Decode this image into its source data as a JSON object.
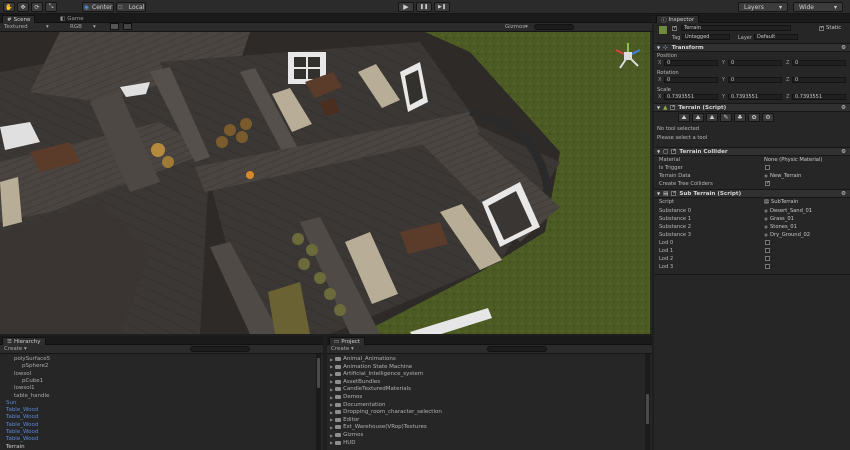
{
  "toolbar": {
    "pivot_center": "Center",
    "pivot_local": "Local",
    "play_symbol": "▶",
    "pause_symbol": "❚❚",
    "step_symbol": "▶❚",
    "layers": "Layers",
    "layout": "Wide"
  },
  "scene": {
    "tab_scene": "Scene",
    "tab_game": "Game",
    "draw_mode": "Textured",
    "render_mode": "RGB",
    "gizmos": "Gizmos",
    "search_placeholder": "All"
  },
  "inspector": {
    "tab": "Inspector",
    "object_name": "Terrain",
    "static_label": "Static",
    "tag_label": "Tag",
    "tag_value": "Untagged",
    "layer_label": "Layer",
    "layer_value": "Default",
    "transform": {
      "title": "Transform",
      "position_label": "Position",
      "rotation_label": "Rotation",
      "scale_label": "Scale",
      "position": [
        "0",
        "0",
        "0"
      ],
      "rotation": [
        "0",
        "0",
        "0"
      ],
      "scale": [
        "0.7393551",
        "0.7393551",
        "0.7393551"
      ]
    },
    "terrain_script": {
      "title": "Terrain (Script)",
      "no_tool": "No tool selected",
      "select_tool": "Please select a tool"
    },
    "terrain_collider": {
      "title": "Terrain Collider",
      "material_label": "Material",
      "material_value": "None (Physic Material)",
      "is_trigger_label": "Is Trigger",
      "terrain_data_label": "Terrain Data",
      "terrain_data_value": "New_Terrain",
      "create_tree_label": "Create Tree Colliders"
    },
    "sub_terrain": {
      "title": "Sub Terrain (Script)",
      "script_label": "Script",
      "script_value": "SubTerrain",
      "substances": [
        {
          "label": "Substance 0",
          "value": "Desert_Sand_01"
        },
        {
          "label": "Substance 1",
          "value": "Grass_01"
        },
        {
          "label": "Substance 2",
          "value": "Stones_01"
        },
        {
          "label": "Substance 3",
          "value": "Dry_Ground_02"
        }
      ],
      "lods": [
        "Lod 0",
        "Lod 1",
        "Lod 2",
        "Lod 3"
      ]
    }
  },
  "hierarchy": {
    "tab": "Hierarchy",
    "create": "Create ▾",
    "items": [
      {
        "label": "polySurface5",
        "color": "#a9a9a9",
        "indent": 1
      },
      {
        "label": "pSphere2",
        "color": "#a9a9a9",
        "indent": 2
      },
      {
        "label": "lowsol",
        "color": "#a9a9a9",
        "indent": 1
      },
      {
        "label": "pCube1",
        "color": "#a9a9a9",
        "indent": 2
      },
      {
        "label": "lowsol1",
        "color": "#a9a9a9",
        "indent": 1
      },
      {
        "label": "table_handle",
        "color": "#a9a9a9",
        "indent": 1
      },
      {
        "label": "Sun",
        "color": "#5b86d6",
        "indent": 0
      },
      {
        "label": "Table_Wood",
        "color": "#5b86d6",
        "indent": 0
      },
      {
        "label": "Table_Wood",
        "color": "#5b86d6",
        "indent": 0
      },
      {
        "label": "Table_Wood",
        "color": "#5b86d6",
        "indent": 0
      },
      {
        "label": "Table_Wood",
        "color": "#5b86d6",
        "indent": 0
      },
      {
        "label": "Table_Wood",
        "color": "#5b86d6",
        "indent": 0
      },
      {
        "label": "Terrain",
        "color": "#d0d0d0",
        "indent": 0
      }
    ]
  },
  "project": {
    "tab": "Project",
    "create": "Create ▾",
    "items": [
      "Animal_Animations",
      "Animation State Machine",
      "Artificial_Intelligence_system",
      "AssetBundles",
      "CandleTexturedMaterials",
      "Demos",
      "Documentation",
      "Dropping_room_character_selection",
      "Editor",
      "Ext_Warehouse(VRop)Textures",
      "Gizmos",
      "HUD"
    ]
  }
}
